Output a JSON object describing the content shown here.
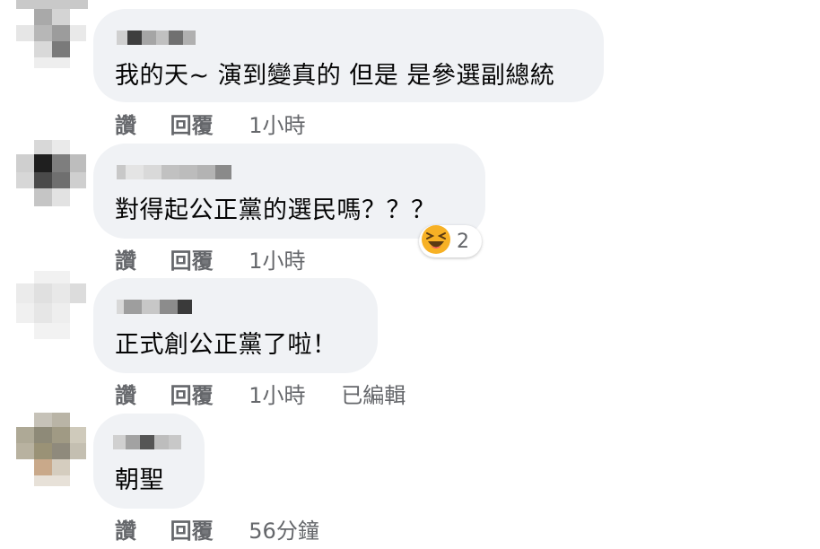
{
  "comments": [
    {
      "text": "我的天~ 演到變真的 但是 是參選副總統",
      "actions": {
        "like": "讚",
        "reply": "回覆",
        "time": "1小時",
        "edited": ""
      }
    },
    {
      "text": "對得起公正黨的選民嗎？？？",
      "actions": {
        "like": "讚",
        "reply": "回覆",
        "time": "1小時",
        "edited": ""
      },
      "reaction": {
        "icon": "laughing-emoji-icon",
        "count": "2"
      }
    },
    {
      "text": "正式創公正黨了啦！",
      "actions": {
        "like": "讚",
        "reply": "回覆",
        "time": "1小時",
        "edited": "已編輯"
      }
    },
    {
      "text": "朝聖",
      "actions": {
        "like": "讚",
        "reply": "回覆",
        "time": "56分鐘",
        "edited": ""
      }
    }
  ],
  "colors": {
    "bubble": "#f0f2f5",
    "text": "#050505",
    "meta": "#65676b",
    "reaction_yellow": "#f7b125"
  }
}
